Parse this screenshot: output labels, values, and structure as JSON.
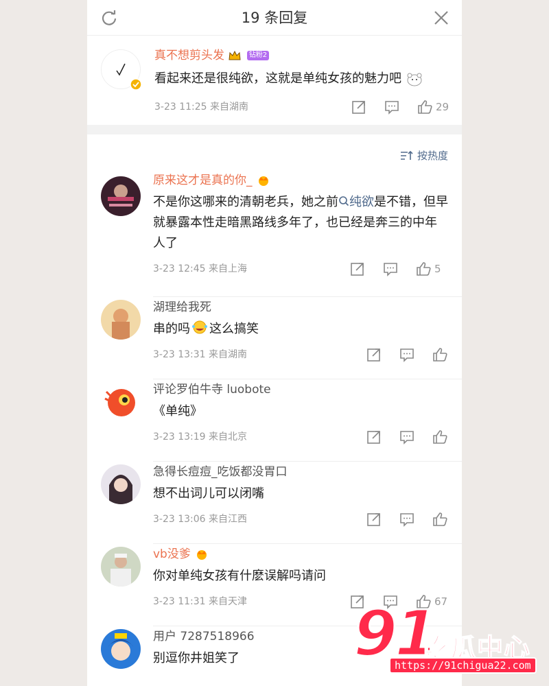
{
  "header": {
    "title": "19 条回复"
  },
  "root": {
    "user": "真不想剪头发",
    "tag": "钻粉2",
    "text": "看起来还是很纯欲，这就是单纯女孩的魅力吧",
    "meta": "3-23 11:25  来自湖南",
    "likes": "29"
  },
  "sort_label": "按热度",
  "comments": [
    {
      "user": "原来这才是真的你_",
      "text_a": "不是你这哪来的清朝老兵，她之前",
      "search": "纯欲",
      "text_b": "是不错，但早就暴露本性走暗黑路线多年了，也已经是奔三的中年人了",
      "meta": "3-23 12:45  来自上海",
      "likes": "5"
    },
    {
      "user": "湖理给我死",
      "text_a": "串的吗",
      "text_b": "这么搞笑",
      "meta": "3-23 13:31  来自湖南",
      "likes": ""
    },
    {
      "user": "评论罗伯牛寺 luobote",
      "text": "《单纯》",
      "meta": "3-23 13:19  来自北京",
      "likes": ""
    },
    {
      "user": "急得长痘痘_吃饭都没胃口",
      "text": "想不出词儿可以闭嘴",
      "meta": "3-23 13:06  来自江西",
      "likes": ""
    },
    {
      "user": "vb没爹",
      "text": "你对单纯女孩有什麽误解吗请问",
      "meta": "3-23 11:31  来自天津",
      "likes": "67"
    },
    {
      "user": "用户 7287518966",
      "text": "别逗你井姐笑了",
      "meta": "",
      "likes": ""
    }
  ],
  "watermark": {
    "num": "91",
    "cn": "吃瓜中心",
    "url": "https://91chigua22.com"
  },
  "colors": {
    "orange_name": "#eb7350",
    "link": "#506a8c",
    "watermark": "#ff2a4a"
  }
}
